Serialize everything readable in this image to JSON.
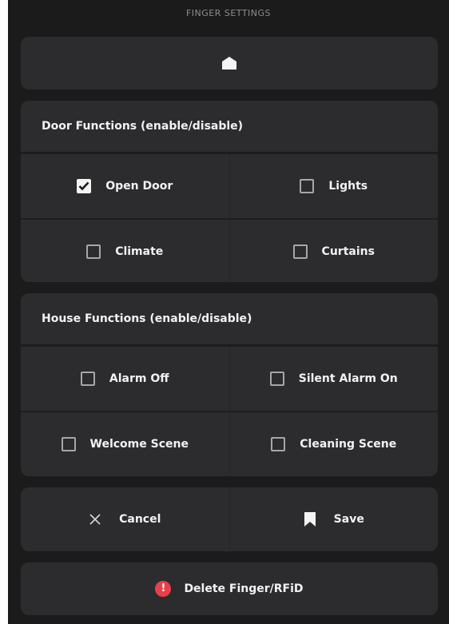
{
  "header": {
    "title": "FINGER SETTINGS",
    "home_icon": "home-icon"
  },
  "door_functions": {
    "title": "Door Functions (enable/disable)",
    "items": [
      {
        "label": "Open Door",
        "checked": true
      },
      {
        "label": "Lights",
        "checked": false
      },
      {
        "label": "Climate",
        "checked": false
      },
      {
        "label": "Curtains",
        "checked": false
      }
    ]
  },
  "house_functions": {
    "title": "House Functions (enable/disable)",
    "items": [
      {
        "label": "Alarm Off",
        "checked": false
      },
      {
        "label": "Silent Alarm On",
        "checked": false
      },
      {
        "label": "Welcome Scene",
        "checked": false
      },
      {
        "label": "Cleaning Scene",
        "checked": false
      }
    ]
  },
  "actions": {
    "cancel_label": "Cancel",
    "cancel_icon": "close-icon",
    "save_label": "Save",
    "save_icon": "bookmark-icon"
  },
  "delete": {
    "label": "Delete Finger/RFiD",
    "icon": "alert-icon",
    "icon_glyph": "!",
    "icon_color": "#e8404a"
  },
  "colors": {
    "background": "#1b1b1c",
    "card": "#2c2c2e",
    "text": "#f2f2f2"
  }
}
